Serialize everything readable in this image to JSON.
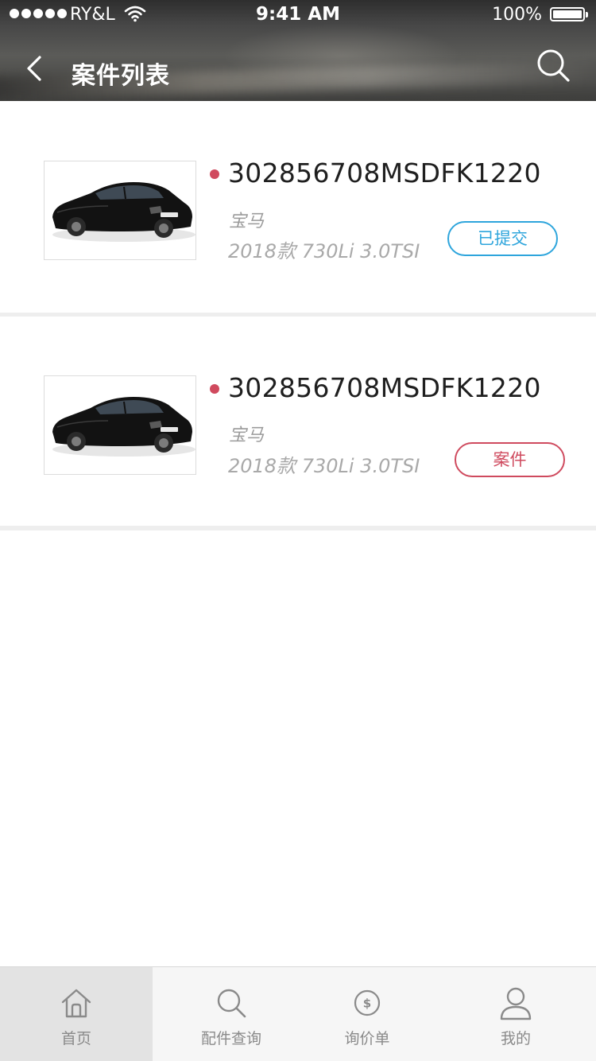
{
  "status_bar": {
    "carrier": "RY&L",
    "time": "9:41 AM",
    "battery": "100%"
  },
  "nav": {
    "title": "案件列表",
    "back_icon": "chevron-left-icon",
    "search_icon": "search-icon"
  },
  "cases": [
    {
      "case_no": "302856708MSDFK1220",
      "brand": "宝马",
      "model": "2018款 730Li 3.0TSI",
      "status": "已提交",
      "status_color": "#2ea5dc"
    },
    {
      "case_no": "302856708MSDFK1220",
      "brand": "宝马",
      "model": "2018款 730Li 3.0TSI",
      "status": "案件",
      "status_color": "#cf4a5e"
    }
  ],
  "colors": {
    "unread_dot": "#d04a5e",
    "separator": "#eeeeee"
  },
  "tabbar": {
    "items": [
      {
        "label": "首页",
        "icon": "home-icon",
        "active": true
      },
      {
        "label": "配件查询",
        "icon": "search-icon",
        "active": false
      },
      {
        "label": "询价单",
        "icon": "dollar-coin-icon",
        "active": false
      },
      {
        "label": "我的",
        "icon": "user-icon",
        "active": false
      }
    ]
  }
}
